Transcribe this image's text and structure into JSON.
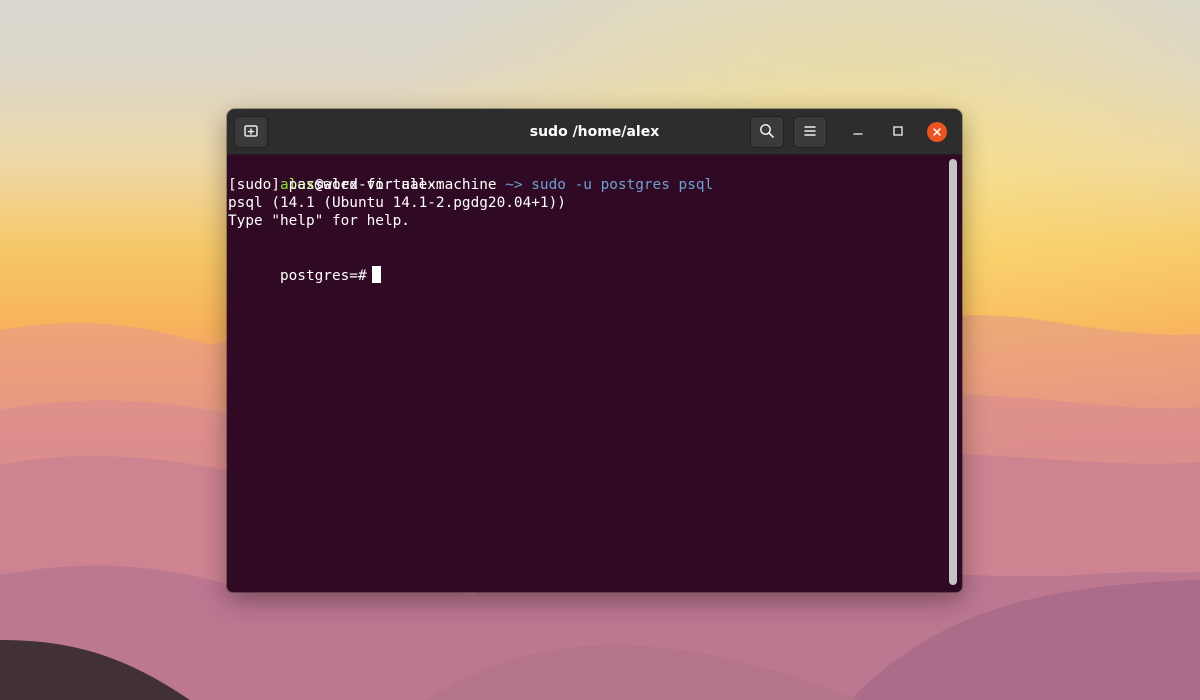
{
  "window": {
    "title": "sudo /home/alex"
  },
  "header": {
    "new_tab_icon": "new-tab-icon",
    "search_icon": "search-icon",
    "menu_icon": "hamburger-menu-icon",
    "minimize_icon": "minimize-icon",
    "maximize_icon": "maximize-icon",
    "close_icon": "close-icon",
    "close_color": "#e95420"
  },
  "terminal": {
    "lines": [
      {
        "user": "alex",
        "host_text": "@alex-virtual-machine",
        "directory": " ~>",
        "command": " sudo -u postgres psql"
      },
      {
        "text": "[sudo] password for alex:"
      },
      {
        "text": "psql (14.1 (Ubuntu 14.1-2.pgdg20.04+1))"
      },
      {
        "text": "Type \"help\" for help."
      },
      {
        "prompt": "postgres=#"
      }
    ],
    "colors": {
      "background": "#300a24",
      "user": "#8ae234",
      "path": "#729fcf",
      "text": "#ffffff"
    }
  }
}
